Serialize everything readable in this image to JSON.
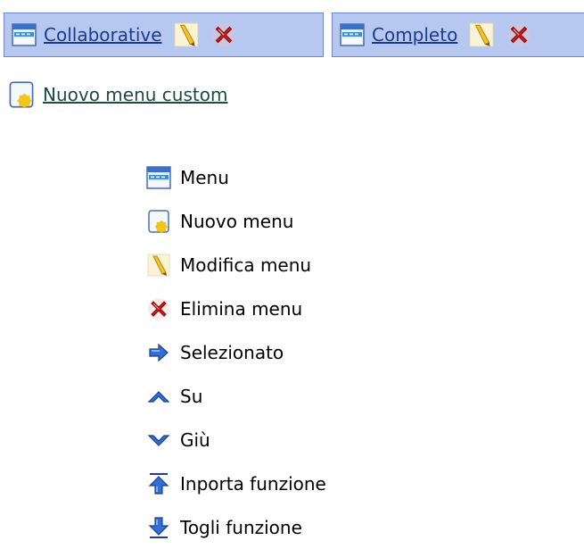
{
  "tabs": [
    {
      "label": "Collaborative",
      "icons": [
        "menu-icon",
        "edit-icon",
        "delete-icon"
      ]
    },
    {
      "label": "Completo",
      "icons": [
        "menu-icon",
        "edit-icon",
        "delete-icon"
      ]
    }
  ],
  "new_custom": {
    "label": "Nuovo menu custom",
    "icon": "new-menu-icon"
  },
  "legend": {
    "items": [
      {
        "label": "Menu",
        "icon": "menu-icon"
      },
      {
        "label": "Nuovo menu",
        "icon": "new-menu-icon"
      },
      {
        "label": "Modifica menu",
        "icon": "edit-icon"
      },
      {
        "label": "Elimina menu",
        "icon": "delete-icon"
      },
      {
        "label": "Selezionato",
        "icon": "arrow-right-icon"
      },
      {
        "label": "Su",
        "icon": "chevron-up-icon"
      },
      {
        "label": "Giù",
        "icon": "chevron-down-icon"
      },
      {
        "label": "Inporta funzione",
        "icon": "import-icon"
      },
      {
        "label": "Togli funzione",
        "icon": "remove-icon"
      }
    ]
  },
  "colors": {
    "tab_bg": "#b6c8f0",
    "tab_border": "#6f86c9",
    "link": "#1a3c8f",
    "custom_link": "#1e4a40",
    "delete_red": "#d21a1a",
    "arrow_blue": "#2f6fd6"
  }
}
